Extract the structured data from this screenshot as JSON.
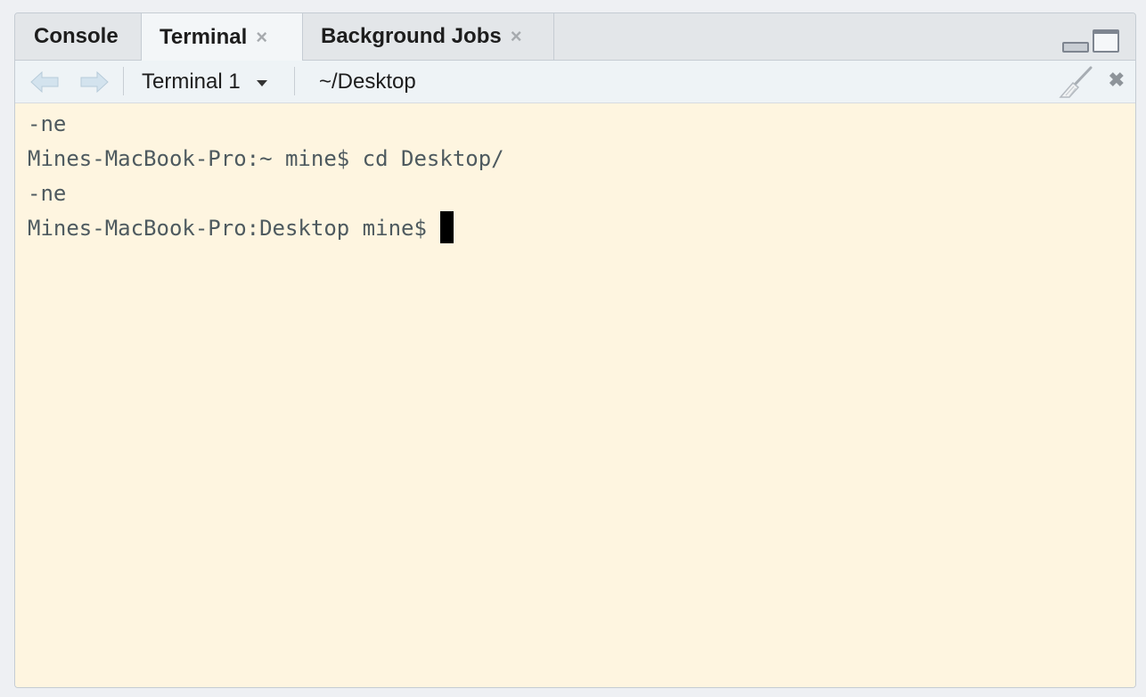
{
  "tabs": [
    {
      "label": "Console",
      "closable": false,
      "active": false
    },
    {
      "label": "Terminal",
      "closable": true,
      "active": true
    },
    {
      "label": "Background Jobs",
      "closable": true,
      "active": false
    }
  ],
  "toolbar": {
    "terminal_selector": "Terminal 1",
    "working_directory": "~/Desktop"
  },
  "terminal": {
    "lines": [
      "-ne",
      "Mines-MacBook-Pro:~ mine$ cd Desktop/",
      "-ne",
      "Mines-MacBook-Pro:Desktop mine$"
    ]
  },
  "icons": {
    "tab_close": "×",
    "terminal_close": "✖"
  },
  "colors": {
    "terminal_background": "#fef5e0",
    "terminal_text": "#4e5a5f",
    "cursor": "#000000"
  }
}
